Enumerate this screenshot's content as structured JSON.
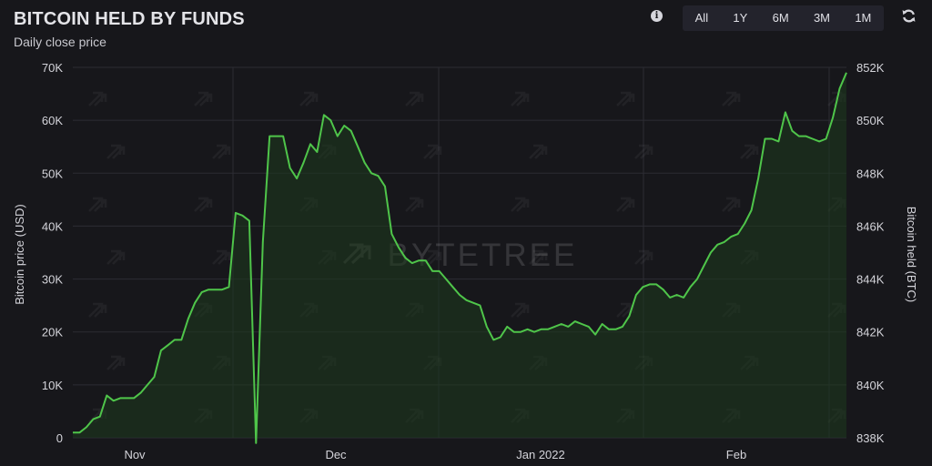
{
  "header": {
    "title": "BITCOIN HELD BY FUNDS",
    "subtitle": "Daily close price",
    "info_icon": "info-icon",
    "refresh_icon": "refresh-icon",
    "range_options": [
      "All",
      "1Y",
      "6M",
      "3M",
      "1M"
    ]
  },
  "chart_data": {
    "type": "line",
    "watermark": "BYTETREE",
    "ylabel": "Bitcoin price (USD)",
    "y2label": "Bitcoin held (BTC)",
    "ylim": [
      0,
      70000
    ],
    "y2lim": [
      838000,
      852000
    ],
    "y_ticks": [
      "0",
      "10K",
      "20K",
      "30K",
      "40K",
      "50K",
      "60K",
      "70K"
    ],
    "y2_ticks": [
      "838K",
      "840K",
      "842K",
      "844K",
      "846K",
      "848K",
      "850K",
      "852K"
    ],
    "x_ticks": [
      "Nov",
      "Dec",
      "Jan 2022",
      "Feb"
    ],
    "grid": true,
    "colors": {
      "line": "#4fc54a",
      "fill": "#1e3a1e",
      "background": "#17171b",
      "grid": "#2c2c33"
    },
    "series": [
      {
        "axis": "right",
        "values": [
          838200,
          838200,
          838400,
          838700,
          838800,
          839600,
          839400,
          839500,
          839500,
          839500,
          839700,
          840000,
          840300,
          841300,
          841500,
          841700,
          841700,
          842500,
          843100,
          843500,
          843600,
          843600,
          843600,
          843700,
          846500,
          846400,
          846200,
          837800,
          845400,
          849400,
          849400,
          849400,
          848200,
          847800,
          848400,
          849100,
          848800,
          850200,
          850000,
          849400,
          849800,
          849600,
          849000,
          848400,
          848000,
          847900,
          847500,
          845700,
          845200,
          844800,
          844600,
          844700,
          844700,
          844300,
          844300,
          844000,
          843700,
          843400,
          843200,
          843100,
          843000,
          842200,
          841700,
          841800,
          842200,
          842000,
          842000,
          842100,
          842000,
          842100,
          842100,
          842200,
          842300,
          842200,
          842400,
          842300,
          842200,
          841900,
          842300,
          842100,
          842100,
          842200,
          842600,
          843400,
          843700,
          843800,
          843800,
          843600,
          843300,
          843400,
          843300,
          843700,
          844000,
          844500,
          845000,
          845300,
          845400,
          845600,
          845700,
          846100,
          846600,
          847800,
          849300,
          849300,
          849200,
          850300,
          849600,
          849400,
          849400,
          849300,
          849200,
          849300,
          850100,
          851200,
          851800
        ],
        "x_start_day": 0,
        "x_end_day": 111
      }
    ]
  }
}
